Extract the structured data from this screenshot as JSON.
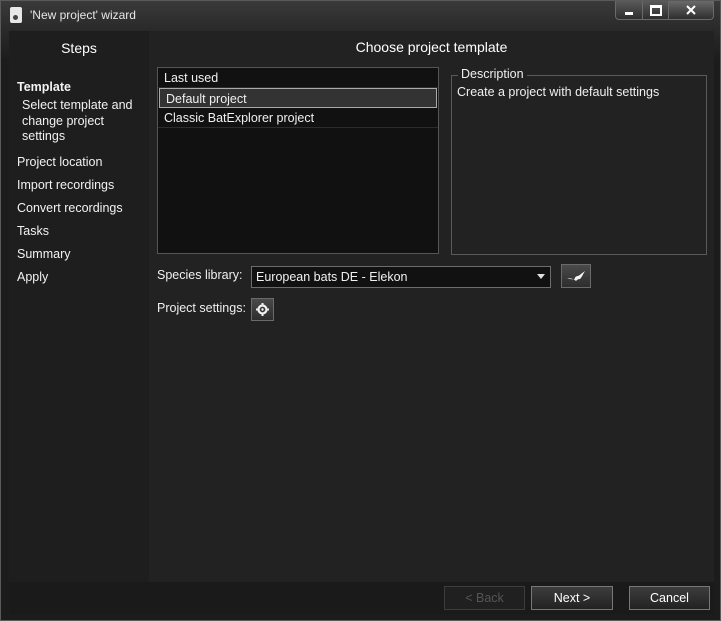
{
  "window": {
    "title": "'New project' wizard",
    "caption_buttons": [
      "minimize",
      "maximize",
      "close"
    ]
  },
  "steps": {
    "title": "Steps",
    "active": {
      "label": "Template",
      "subtitle": "Select template and change project settings"
    },
    "items": [
      "Project location",
      "Import recordings",
      "Convert recordings",
      "Tasks",
      "Summary",
      "Apply"
    ]
  },
  "main": {
    "title": "Choose project template",
    "templates": [
      {
        "label": "Last used",
        "selected": false
      },
      {
        "label": "Default project",
        "selected": true
      },
      {
        "label": "Classic BatExplorer project",
        "selected": false
      }
    ],
    "description": {
      "legend": "Description",
      "text": "Create a project with default settings"
    },
    "species_library": {
      "label": "Species library:",
      "value": "European bats DE - Elekon",
      "button_icon": "bat-icon"
    },
    "project_settings": {
      "label": "Project settings:",
      "button_icon": "gear-icon"
    }
  },
  "footer": {
    "back_label": "< Back",
    "back_enabled": false,
    "next_label": "Next >",
    "cancel_label": "Cancel"
  }
}
